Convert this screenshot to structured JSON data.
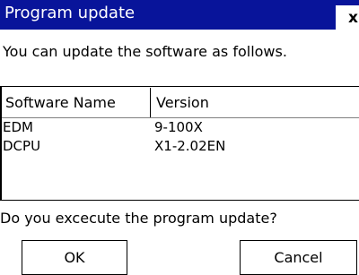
{
  "window": {
    "title": "Program update",
    "close_label": "x"
  },
  "message": "You can update the software as follows.",
  "table": {
    "columns": [
      "Software Name",
      "Version"
    ],
    "rows": [
      [
        "EDM",
        "9-100X"
      ],
      [
        "DCPU",
        "X1-2.02EN"
      ]
    ]
  },
  "question": "Do you excecute the program update?",
  "buttons": {
    "ok": "OK",
    "cancel": "Cancel"
  },
  "colors": {
    "titlebar": "#08149a",
    "background": "#ffffff"
  }
}
